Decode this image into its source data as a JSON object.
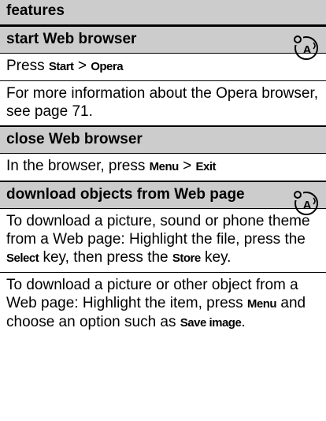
{
  "header": {
    "title": "features"
  },
  "features": [
    {
      "title": "start Web browser",
      "icon": "network-feature-icon",
      "paragraphs": [
        {
          "pre": "Press ",
          "k1": "Start",
          "mid": " > ",
          "k2": "Opera",
          "post": ""
        },
        {
          "text": "For more information about the Opera browser, see page 71."
        }
      ]
    },
    {
      "title": "close Web browser",
      "paragraphs": [
        {
          "pre": "In the browser, press ",
          "k1": "Menu",
          "mid": " > ",
          "k2": "Exit",
          "post": ""
        }
      ]
    },
    {
      "title": "download objects from Web page",
      "icon": "network-feature-icon",
      "paragraphs": [
        {
          "pre": "To download a picture, sound or phone theme from a Web page: Highlight the file, press the ",
          "k1": "Select",
          "mid": " key, then press the ",
          "k2": "Store",
          "post": " key."
        },
        {
          "pre": "To download a picture or other object from a Web page: Highlight the item, press ",
          "k1": "Menu",
          "mid": " and choose an option such as ",
          "k2": "Save image",
          "post": "."
        }
      ]
    }
  ]
}
